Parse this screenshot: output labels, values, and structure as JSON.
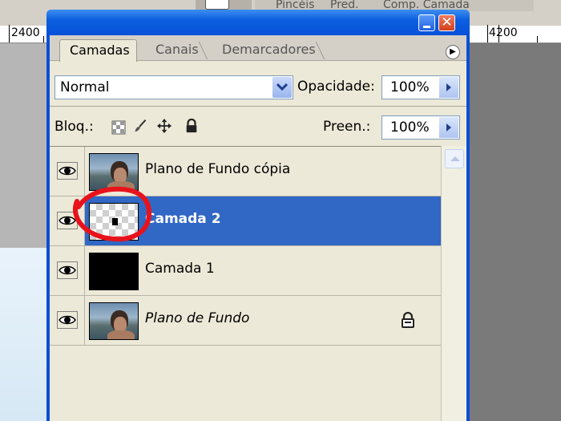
{
  "ruler": {
    "left_label": "2400",
    "right_label": "4200"
  },
  "background_tabs": {
    "items": [
      "Pincéis",
      "Pred.",
      "Comp. Camada"
    ]
  },
  "panel": {
    "tabs": [
      {
        "label": "Camadas",
        "active": true
      },
      {
        "label": "Canais",
        "active": false
      },
      {
        "label": "Demarcadores",
        "active": false
      }
    ],
    "menu_icon": "circle-arrow-right-icon",
    "blend_mode": "Normal",
    "opacity_label": "Opacidade:",
    "opacity_value": "100%",
    "lock_label": "Bloq.:",
    "lock_icons": [
      "lock-transparency-icon",
      "lock-brush-icon",
      "lock-move-icon",
      "lock-all-icon"
    ],
    "fill_label": "Preen.:",
    "fill_value": "100%"
  },
  "layers": [
    {
      "name": "Plano de Fundo cópia",
      "thumbnail": "photo",
      "visible": true,
      "selected": false,
      "locked": false
    },
    {
      "name": "Camada 2",
      "thumbnail": "transparent",
      "visible": true,
      "selected": true,
      "locked": false
    },
    {
      "name": "Camada 1",
      "thumbnail": "black",
      "visible": true,
      "selected": false,
      "locked": false
    },
    {
      "name": "Plano de Fundo",
      "thumbnail": "photo",
      "visible": true,
      "selected": false,
      "locked": true,
      "italic": true
    }
  ],
  "colors": {
    "selection": "#3167c5",
    "annotation": "#e8121b",
    "titlebar": "#0a4fd6"
  }
}
